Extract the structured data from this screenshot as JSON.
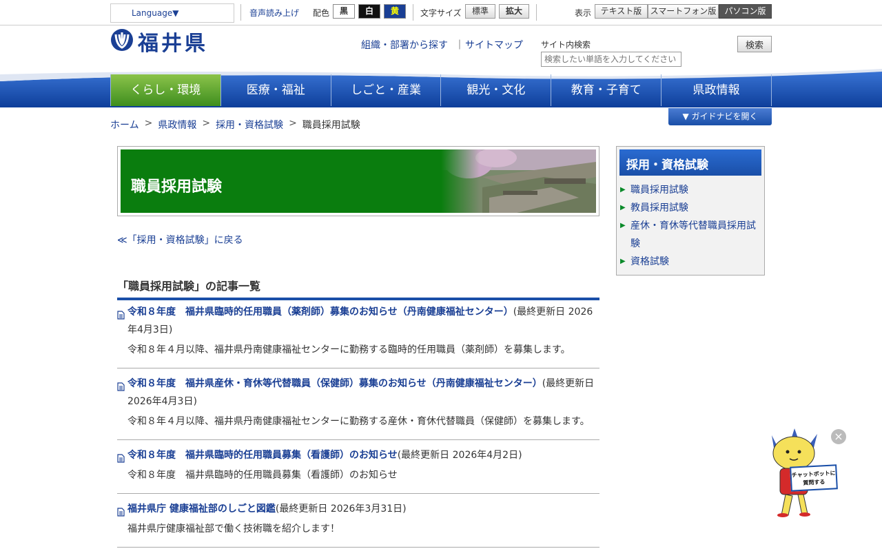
{
  "topbar": {
    "language": "Language▼",
    "speech": "音声読み上げ",
    "color_label": "配色",
    "color_black": "黒",
    "color_white": "白",
    "color_yellow": "黄",
    "font_label": "文字サイズ",
    "font_normal": "標準",
    "font_large": "拡大",
    "display_label": "表示",
    "display_text": "テキスト版",
    "display_smartphone": "スマートフォン版",
    "display_pc": "パソコン版"
  },
  "header": {
    "logo_text": "福井県",
    "org_link": "組織・部署から探す",
    "sep": "｜",
    "sitemap_link": "サイトマップ",
    "search_label": "サイト内検索",
    "search_placeholder": "検索したい単語を入力してください",
    "search_button": "検索"
  },
  "gnav": [
    "くらし・環境",
    "医療・福祉",
    "しごと・産業",
    "観光・文化",
    "教育・子育て",
    "県政情報"
  ],
  "breadcrumb": {
    "home": "ホーム",
    "sep": ">",
    "item1": "県政情報",
    "item2": "採用・資格試験",
    "current": "職員採用試験"
  },
  "guide_button": "▼ ガイドナビを開く",
  "banner_title": "職員採用試験",
  "back_link": "≪「採用・資格試験」に戻る",
  "list_heading": "「職員採用試験」の記事一覧",
  "articles": [
    {
      "title": "令和８年度　福井県臨時的任用職員（薬剤師）募集のお知らせ（丹南健康福祉センター）",
      "updated": "(最終更新日 2026年4月3日)",
      "desc": "令和８年４月以降、福井県丹南健康福祉センターに勤務する臨時的任用職員（薬剤師）を募集します。"
    },
    {
      "title": "令和８年度　福井県産休・育休等代替職員（保健師）募集のお知らせ（丹南健康福祉センター）",
      "updated": "(最終更新日 2026年4月3日)",
      "desc": "令和８年４月以降、福井県丹南健康福祉センターに勤務する産休・育休代替職員（保健師）を募集します。"
    },
    {
      "title": "令和８年度　福井県臨時的任用職員募集（看護師）のお知らせ",
      "updated": "(最終更新日 2026年4月2日)",
      "desc": "令和８年度　福井県臨時的任用職員募集（看護師）のお知らせ"
    },
    {
      "title": "福井県庁 健康福祉部のしごと図鑑",
      "updated": "(最終更新日 2026年3月31日)",
      "desc": "福井県庁健康福祉部で働く技術職を紹介します！"
    }
  ],
  "sidebar": {
    "heading": "採用・資格試験",
    "items": [
      "職員採用試験",
      "教員採用試験",
      "産休・育休等代替職員採用試験",
      "資格試験"
    ]
  },
  "chatbot": {
    "label_line1": "チャットボットに",
    "label_line2": "質問する",
    "close": "×"
  },
  "colors": {
    "brand_blue": "#1a3f94",
    "nav_blue": "#1a4fa8",
    "banner_green": "#0a7d0e",
    "active_green": "#4a9e26"
  }
}
